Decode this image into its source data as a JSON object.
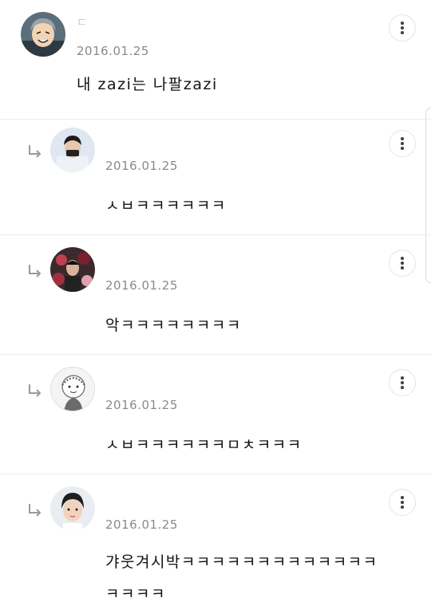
{
  "comments": [
    {
      "name": "ㄷ",
      "date": "2016.01.25",
      "text": "내 zazi는 나팔zazi",
      "reply": false,
      "avatar_icon": "cartoon-avatar-icon"
    },
    {
      "name": "",
      "date": "2016.01.25",
      "text": "ㅅㅂㅋㅋㅋㅋㅋㅋ",
      "reply": true,
      "avatar_icon": "person-photo-icon"
    },
    {
      "name": "",
      "date": "2016.01.25",
      "text": "악ㅋㅋㅋㅋㅋㅋㅋㅋ",
      "reply": true,
      "avatar_icon": "group-photo-icon"
    },
    {
      "name": "",
      "date": "2016.01.25",
      "text": "ㅅㅂㅋㅋㅋㅋㅋㅋㅁㅊㅋㅋㅋ",
      "reply": true,
      "avatar_icon": "sketch-avatar-icon"
    },
    {
      "name": "",
      "date": "2016.01.25",
      "text": "갸웃겨시박ㅋㅋㅋㅋㅋㅋㅋㅋㅋㅋㅋㅋㅋㅋㅋㅋㅋ",
      "reply": true,
      "avatar_icon": "portrait-photo-icon"
    }
  ],
  "colors": {
    "date": "#8a8a8a",
    "divider": "#ececec",
    "text": "#111111"
  },
  "icons": {
    "more": "more-vertical-icon",
    "reply": "reply-arrow-icon"
  }
}
